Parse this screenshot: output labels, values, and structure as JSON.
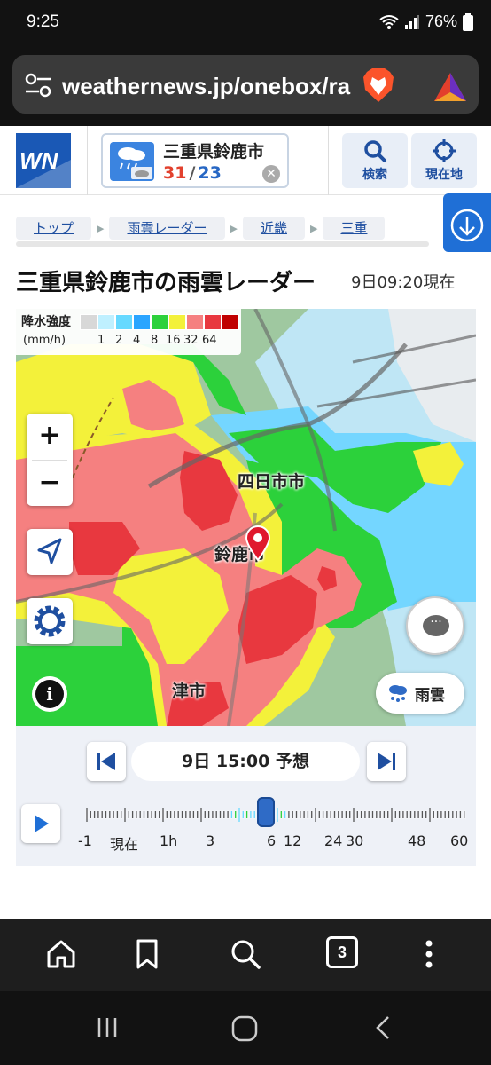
{
  "status": {
    "time": "9:25",
    "battery": "76%"
  },
  "browser": {
    "url": "weathernews.jp/onebox/ra"
  },
  "header": {
    "logo_text": "WN",
    "city": "三重県鈴鹿市",
    "temp_high": "31",
    "temp_sep": "/",
    "temp_low": "23",
    "search_label": "検索",
    "current_location_label": "現在地"
  },
  "breadcrumb": [
    "トップ",
    "雨雲レーダー",
    "近畿",
    "三重"
  ],
  "title": "三重県鈴鹿市の雨雲レーダー",
  "as_of": "9日09:20現在",
  "legend": {
    "title": "降水強度",
    "unit": "(mm/h)",
    "ticks": [
      "1",
      "2",
      "4",
      "8",
      "16",
      "32",
      "64"
    ],
    "colors": [
      "#d8d8d8",
      "#bff0ff",
      "#66d9ff",
      "#2aa5ff",
      "#2cd13b",
      "#f3f13a",
      "#f58080",
      "#e8383f",
      "#c00000"
    ]
  },
  "map": {
    "labels": {
      "yokkaichi": "四日市市",
      "suzuka": "鈴鹿市",
      "tsu": "津市"
    },
    "zoom_in": "+",
    "zoom_out": "−",
    "info": "i",
    "layer_button": "雨雲",
    "chat": "···"
  },
  "timeline": {
    "current": "9日 15:00 予想",
    "labels": [
      "-1",
      "現在",
      "1h",
      "3",
      "6",
      "12",
      "24",
      "30",
      "48",
      "60"
    ]
  },
  "bottom_nav": {
    "tab_count": "3"
  }
}
